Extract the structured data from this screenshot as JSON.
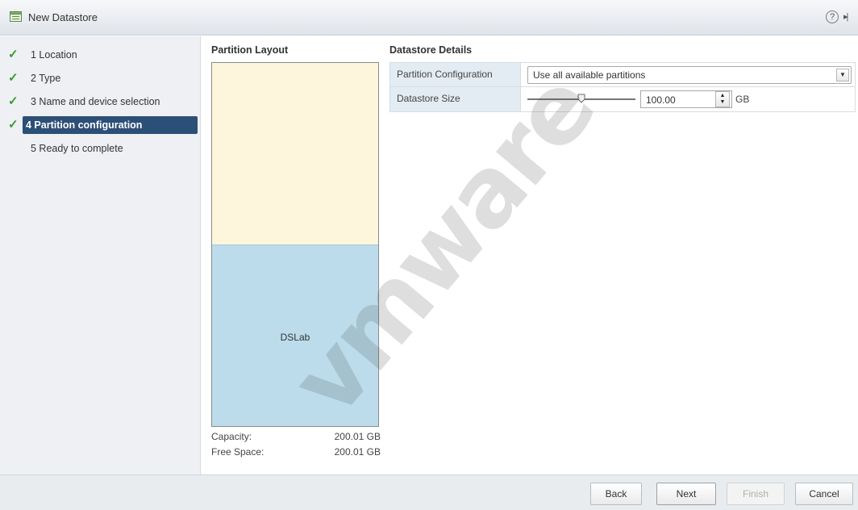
{
  "window": {
    "title": "New Datastore",
    "icon": "datastore-icon",
    "help_label": "?",
    "expand_label": "▸|"
  },
  "steps": [
    {
      "label": "1  Location",
      "done": true
    },
    {
      "label": "2  Type",
      "done": true
    },
    {
      "label": "3  Name and device selection",
      "done": true
    },
    {
      "label": "4  Partition configuration",
      "done": true,
      "active": true
    },
    {
      "label": "5  Ready to complete",
      "done": false
    }
  ],
  "partition_layout": {
    "title": "Partition Layout",
    "partition_label": "DSLab",
    "capacity_label": "Capacity:",
    "capacity_value": "200.01 GB",
    "free_label": "Free Space:",
    "free_value": "200.01 GB",
    "used_fraction": 0.5
  },
  "details": {
    "title": "Datastore Details",
    "partition_config_label": "Partition Configuration",
    "partition_config_value": "Use all available partitions",
    "size_label": "Datastore Size",
    "size_value": "100.00",
    "size_unit": "GB",
    "slider_fraction": 0.5
  },
  "watermark": "vmware",
  "buttons": {
    "back": "Back",
    "next": "Next",
    "finish": "Finish",
    "cancel": "Cancel"
  },
  "colors": {
    "active_step": "#2c4f77",
    "check": "#3a9a2c",
    "free_space": "#fdf6dc",
    "used_space": "#bcdcec"
  }
}
